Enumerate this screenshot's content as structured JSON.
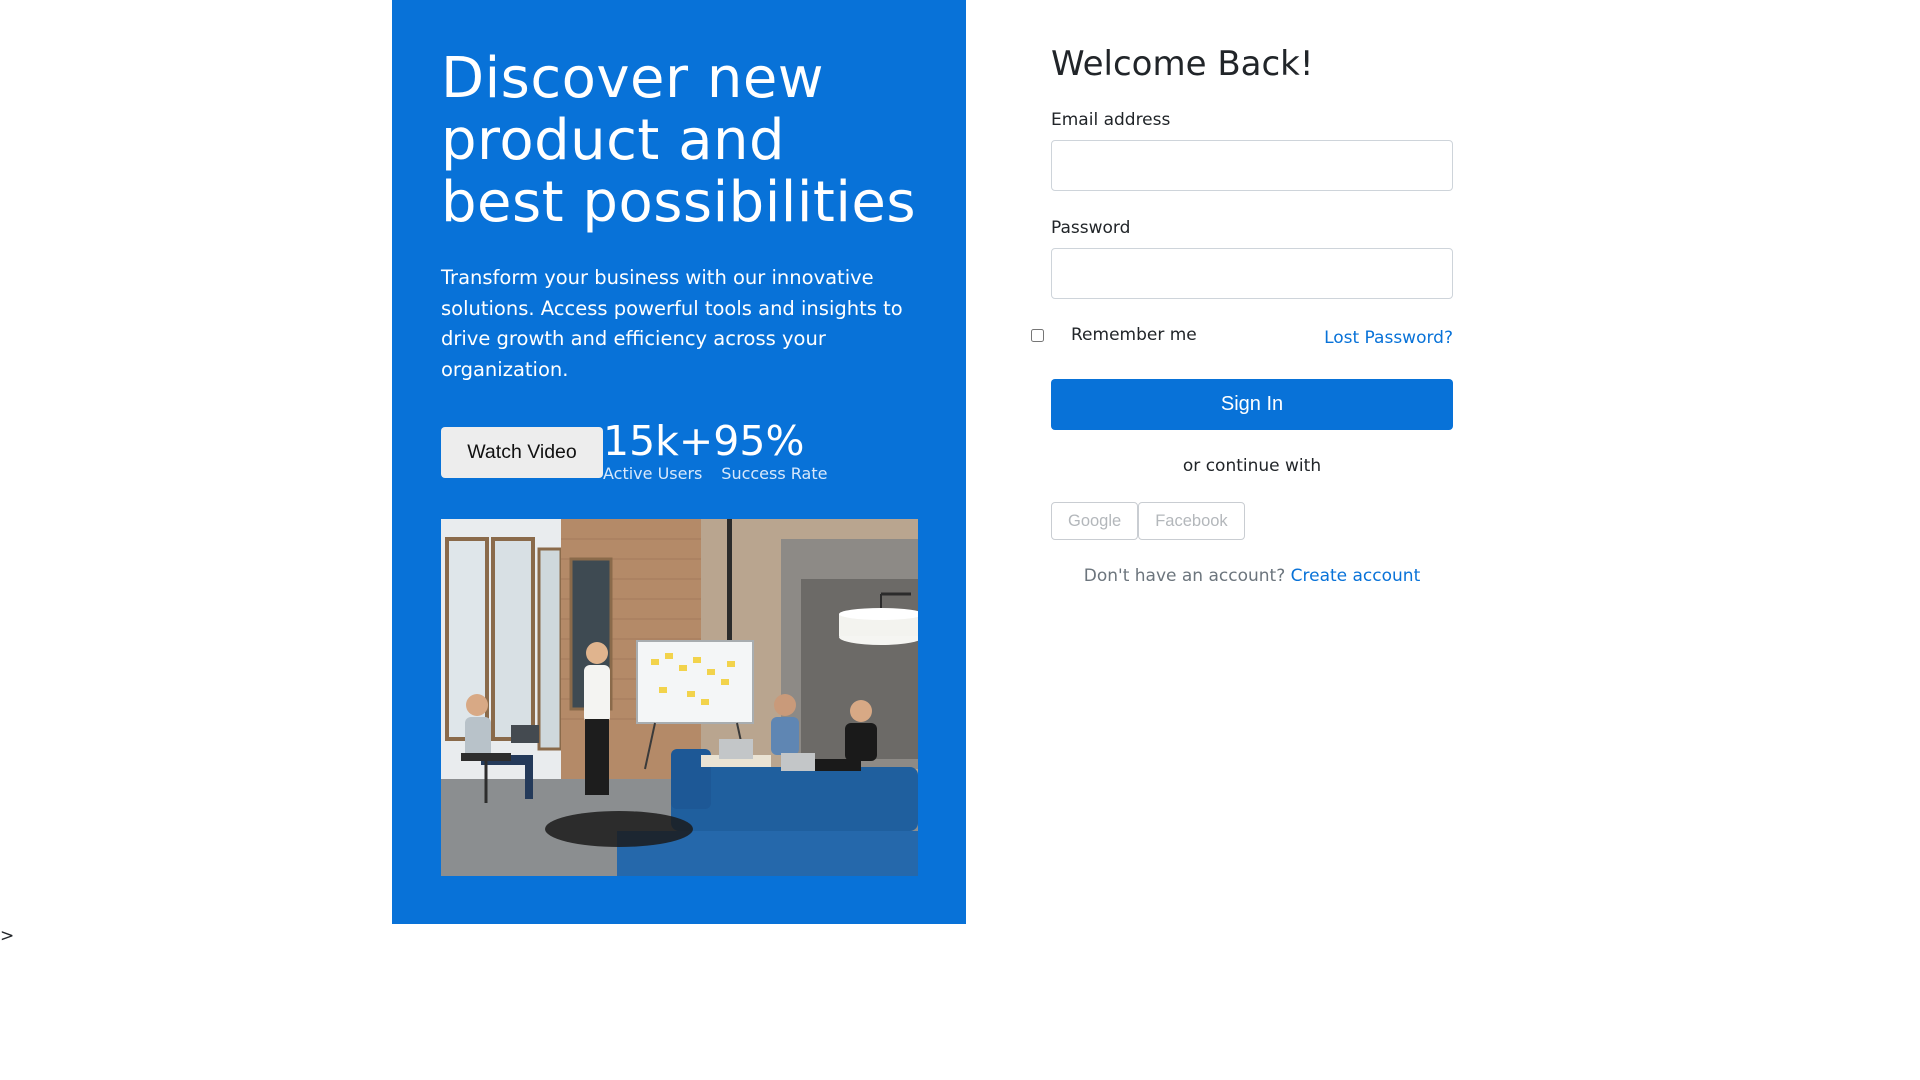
{
  "hero": {
    "title": "Discover new product and best possibilities",
    "description": "Transform your business with our innovative solutions. Access powerful tools and insights to drive growth and efficiency across your organization.",
    "watch_button": "Watch Video",
    "stats": [
      {
        "value": "15k+",
        "label": "Active Users"
      },
      {
        "value": "95%",
        "label": "Success Rate"
      }
    ],
    "image_alt": "team meeting in office",
    "background_color": "#0872d8"
  },
  "login": {
    "title": "Welcome Back!",
    "email_label": "Email address",
    "email_value": "",
    "password_label": "Password",
    "password_value": "",
    "remember_label": "Remember me",
    "remember_checked": false,
    "lost_password": "Lost Password?",
    "signin_button": "Sign In",
    "or_text": "or continue with",
    "social_buttons": [
      "Google",
      "Facebook"
    ],
    "signup_prompt": "Don't have an account?",
    "signup_link": "Create account",
    "accent_color": "#0872d8"
  },
  "stray_text": ">"
}
